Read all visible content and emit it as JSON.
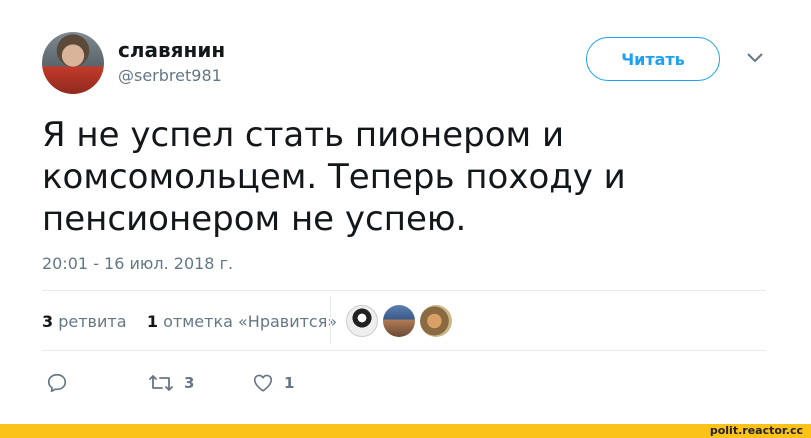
{
  "user": {
    "display_name": "славянин",
    "handle": "@serbret981"
  },
  "follow_button": {
    "label": "Читать"
  },
  "tweet": {
    "text_line1": "Я не успел стать пионером и",
    "text_line2": "комсомольцем. Теперь походу и",
    "text_line3": "пенсионером не успею.",
    "timestamp": "20:01 - 16 июл. 2018 г."
  },
  "stats": {
    "retweets_count": "3",
    "retweets_label": "ретвита",
    "likes_count": "1",
    "likes_label": "отметка «Нравится»"
  },
  "actions": {
    "reply_icon": "reply-icon",
    "retweet_count": "3",
    "like_count": "1"
  },
  "footer": {
    "watermark": "polit.reactor.cc"
  },
  "colors": {
    "accent": "#1da1f2",
    "secondary_text": "#657786",
    "footer_bar": "#fbc31a"
  }
}
